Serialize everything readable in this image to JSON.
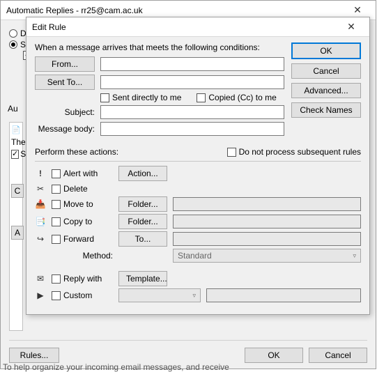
{
  "backWindow": {
    "title": "Automatic Replies - rr25@cam.ac.uk",
    "radioDoNot": "Do no",
    "radioSend": "Send",
    "tabAuto": "Au",
    "panelThe": "The",
    "panelSta": "Sta",
    "btnC": "C",
    "btnA": "A",
    "rulesBtn": "Rules...",
    "okBtn": "OK",
    "cancelBtn": "Cancel",
    "truncated": "To help organize your incoming email messages, and receive"
  },
  "modal": {
    "title": "Edit Rule",
    "condHeader": "When a message arrives that meets the following conditions:",
    "fromBtn": "From...",
    "sentToBtn": "Sent To...",
    "sentDirectly": "Sent directly to me",
    "copiedCc": "Copied (Cc) to me",
    "subjectLbl": "Subject:",
    "msgBodyLbl": "Message body:",
    "okBtn": "OK",
    "cancelBtn": "Cancel",
    "advancedBtn": "Advanced...",
    "checkNamesBtn": "Check Names",
    "performLbl": "Perform these actions:",
    "noProcess": "Do not process subsequent rules",
    "alertWith": "Alert with",
    "actionBtn": "Action...",
    "delete": "Delete",
    "moveTo": "Move to",
    "folderBtn": "Folder...",
    "copyTo": "Copy to",
    "forward": "Forward",
    "toBtn": "To...",
    "methodLbl": "Method:",
    "methodVal": "Standard",
    "replyWith": "Reply with",
    "templateBtn": "Template...",
    "custom": "Custom"
  }
}
